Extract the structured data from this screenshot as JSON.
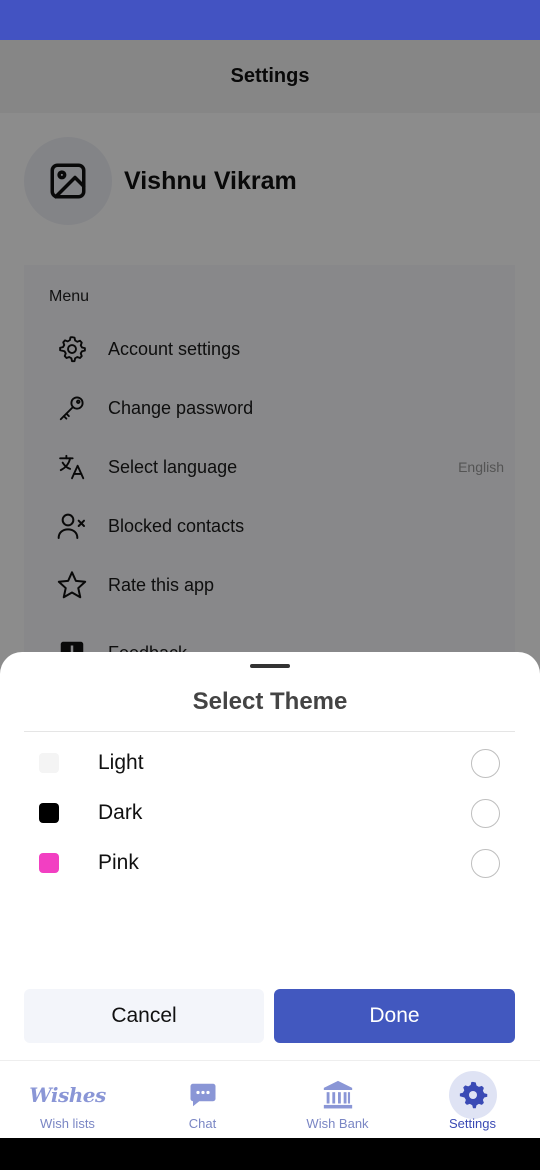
{
  "header": {
    "title": "Settings"
  },
  "profile": {
    "name": "Vishnu Vikram",
    "avatar_icon": "image-placeholder-icon"
  },
  "menu": {
    "heading": "Menu",
    "items": [
      {
        "label": "Account settings",
        "icon": "gear-icon",
        "value": ""
      },
      {
        "label": "Change password",
        "icon": "key-icon",
        "value": ""
      },
      {
        "label": "Select language",
        "icon": "translate-icon",
        "value": "English"
      },
      {
        "label": "Blocked contacts",
        "icon": "user-blocked-icon",
        "value": ""
      },
      {
        "label": "Rate this app",
        "icon": "star-icon",
        "value": ""
      },
      {
        "label": "Feedback",
        "icon": "feedback-icon",
        "value": ""
      }
    ]
  },
  "theme_sheet": {
    "title": "Select Theme",
    "options": [
      {
        "label": "Light",
        "color": "#f4f4f4"
      },
      {
        "label": "Dark",
        "color": "#000000"
      },
      {
        "label": "Pink",
        "color": "#f23fc2"
      }
    ],
    "cancel_label": "Cancel",
    "done_label": "Done"
  },
  "bottom_nav": {
    "items": [
      {
        "label": "Wish lists",
        "logo_text": "Wishes",
        "icon": "wishes-logo-icon"
      },
      {
        "label": "Chat",
        "icon": "chat-icon"
      },
      {
        "label": "Wish Bank",
        "icon": "bank-icon"
      },
      {
        "label": "Settings",
        "icon": "gear-icon",
        "active": true
      }
    ]
  },
  "colors": {
    "status_bar": "#4353c2",
    "accent": "#4258bf",
    "nav_inactive": "#7a86c4",
    "nav_active": "#3a4ab5"
  }
}
